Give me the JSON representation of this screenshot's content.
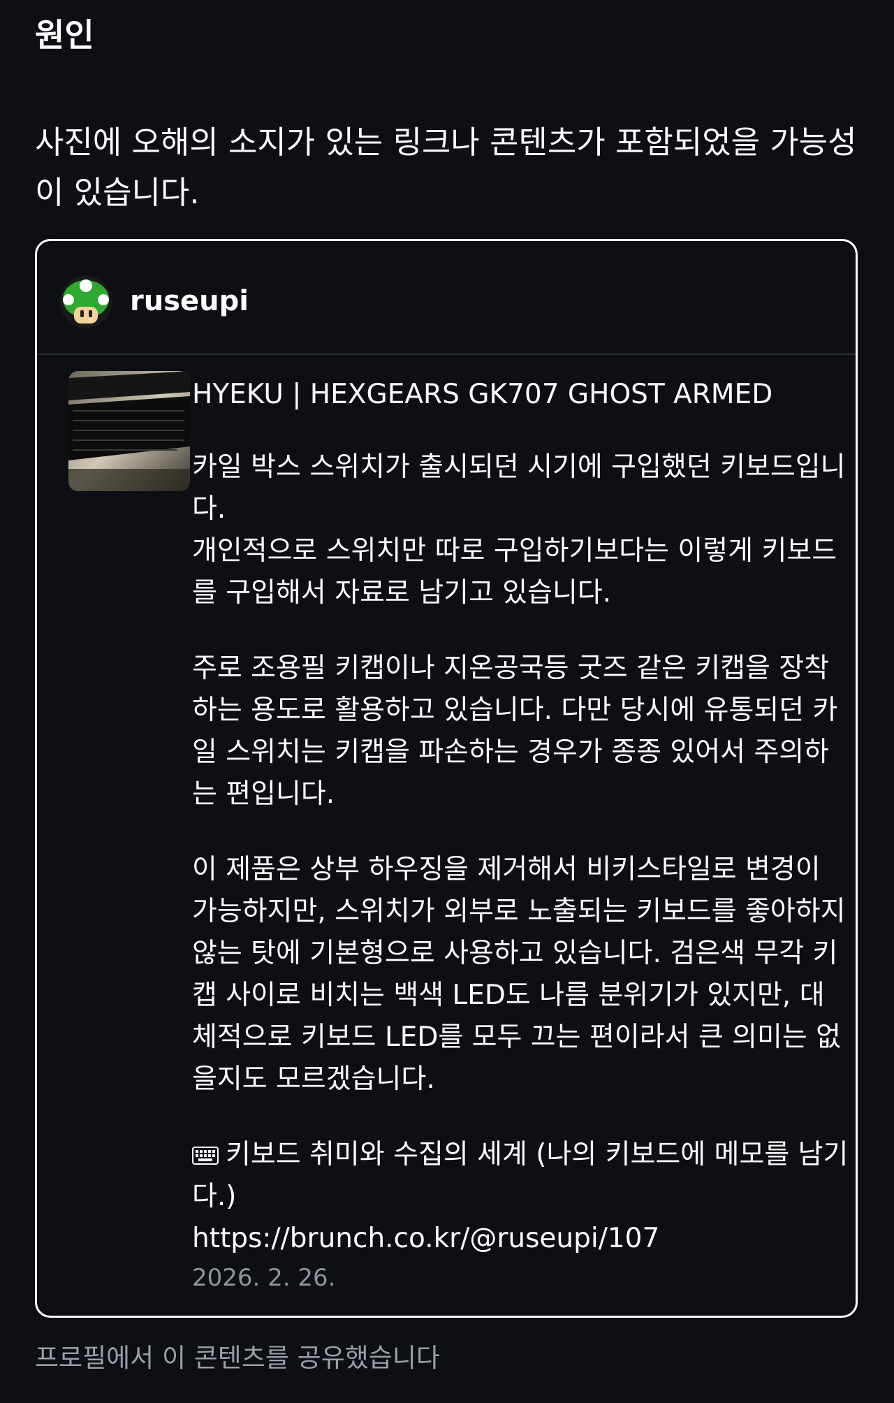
{
  "section": {
    "title": "원인"
  },
  "reason": {
    "text": "사진에 오해의 소지가 있는 링크나 콘텐츠가 포함되었을 가능성이 있습니다."
  },
  "post": {
    "username": "ruseupi",
    "avatar_icon": "mushroom-avatar",
    "thumbnail": "keyboard-photo",
    "title": "HYEKU | HEXGEARS GK707 GHOST ARMED",
    "paragraphs": [
      "카일 박스 스위치가 출시되던 시기에 구입했던 키보드입니다.\n개인적으로 스위치만 따로 구입하기보다는 이렇게 키보드를 구입해서 자료로 남기고 있습니다.",
      "주로 조용필 키캡이나 지온공국등 굿즈 같은 키캡을 장착하는 용도로 활용하고 있습니다. 다만 당시에 유통되던 카일 스위치는 키캡을 파손하는 경우가 종종 있어서 주의하는 편입니다.",
      "이 제품은 상부 하우징을 제거해서 비키스타일로 변경이 가능하지만, 스위치가 외부로 노출되는 키보드를 좋아하지 않는 탓에 기본형으로 사용하고 있습니다. 검은색 무각 키캡 사이로 비치는 백색 LED도 나름 분위기가 있지만, 대체적으로 키보드 LED를 모두 끄는 편이라서 큰 의미는 없을지도 모르겠습니다."
    ],
    "series_icon": "keyboard-icon",
    "series_text": "키보드 취미와 수집의 세계 (나의 키보드에 메모를 남기다.)",
    "link": "https://brunch.co.kr/@ruseupi/107",
    "date": "2026. 2. 26."
  },
  "footer": {
    "text": "프로필에서 이 콘텐츠를 공유했습니다"
  }
}
